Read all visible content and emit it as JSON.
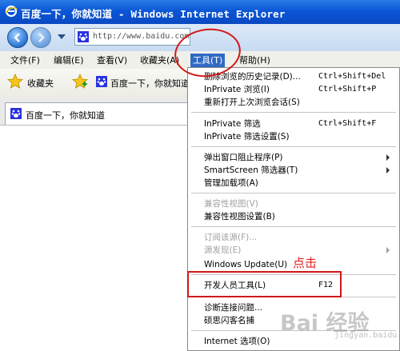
{
  "window": {
    "title": "百度一下，你就知道 - Windows Internet Explorer"
  },
  "navigation": {
    "url": "http://www.baidu.com"
  },
  "menubar": {
    "items": [
      "文件(F)",
      "编辑(E)",
      "查看(V)",
      "收藏夹(A)",
      "工具(T)",
      "帮助(H)"
    ],
    "active_index": 4
  },
  "favorites_bar": {
    "favorites_label": "收藏夹",
    "site_label": "百度一下，你就知道"
  },
  "tab": {
    "label": "百度一下，你就知道"
  },
  "tools_menu": {
    "items": [
      {
        "label": "删除浏览的历史记录(D)...",
        "shortcut": "Ctrl+Shift+Del",
        "disabled": false,
        "submenu": false
      },
      {
        "label": "InPrivate 浏览(I)",
        "shortcut": "Ctrl+Shift+P",
        "disabled": false,
        "submenu": false
      },
      {
        "label": "重新打开上次浏览会话(S)",
        "shortcut": "",
        "disabled": false,
        "submenu": false
      },
      {
        "label": "InPrivate 筛选",
        "shortcut": "Ctrl+Shift+F",
        "disabled": false,
        "submenu": false
      },
      {
        "label": "InPrivate 筛选设置(S)",
        "shortcut": "",
        "disabled": false,
        "submenu": false
      },
      {
        "label": "弹出窗口阻止程序(P)",
        "shortcut": "",
        "disabled": false,
        "submenu": true
      },
      {
        "label": "SmartScreen 筛选器(T)",
        "shortcut": "",
        "disabled": false,
        "submenu": true
      },
      {
        "label": "管理加载项(A)",
        "shortcut": "",
        "disabled": false,
        "submenu": false
      },
      {
        "label": "兼容性视图(V)",
        "shortcut": "",
        "disabled": true,
        "submenu": false
      },
      {
        "label": "兼容性视图设置(B)",
        "shortcut": "",
        "disabled": false,
        "submenu": false
      },
      {
        "label": "订阅该源(F)...",
        "shortcut": "",
        "disabled": true,
        "submenu": false
      },
      {
        "label": "源发现(E)",
        "shortcut": "",
        "disabled": true,
        "submenu": true
      },
      {
        "label": "Windows Update(U)",
        "shortcut": "",
        "disabled": false,
        "submenu": false
      },
      {
        "label": "开发人员工具(L)",
        "shortcut": "F12",
        "disabled": false,
        "submenu": false
      },
      {
        "label": "诊断连接问题...",
        "shortcut": "",
        "disabled": false,
        "submenu": false
      },
      {
        "label": "硕思闪客名捕",
        "shortcut": "",
        "disabled": false,
        "submenu": false
      },
      {
        "label": "Internet 选项(O)",
        "shortcut": "",
        "disabled": false,
        "submenu": false
      }
    ]
  },
  "annotation": {
    "text": "点击"
  },
  "watermark": {
    "text": "Bai 经验",
    "sub": "jingyan.baidu.com"
  },
  "colors": {
    "title_blue": "#0b56d6",
    "menu_highlight": "#316ac5",
    "annotation_red": "#d01818"
  }
}
